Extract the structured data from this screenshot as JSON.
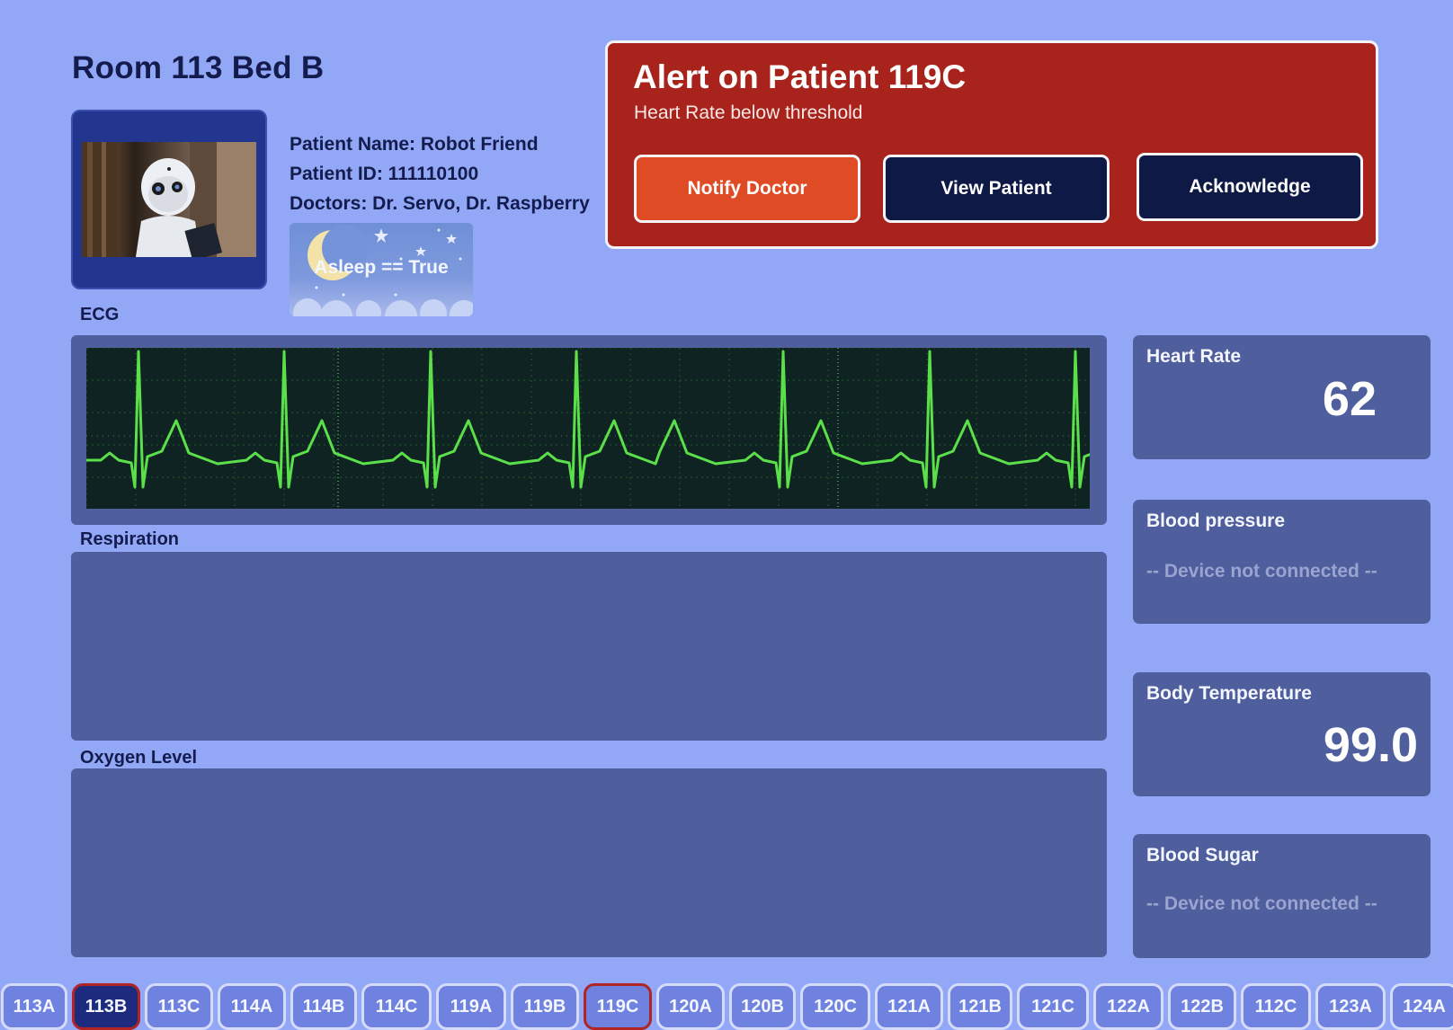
{
  "room": {
    "title": "Room 113 Bed B"
  },
  "patient": {
    "name_line": "Patient Name: Robot Friend",
    "id_line": "Patient ID: 111110100",
    "doctors_line": "Doctors: Dr. Servo, Dr. Raspberry",
    "sleep_status": "Asleep == True"
  },
  "alert": {
    "title": "Alert on Patient 119C",
    "subtitle": "Heart Rate below threshold",
    "notify_label": "Notify Doctor",
    "view_label": "View Patient",
    "ack_label": "Acknowledge",
    "color": "#a8231c"
  },
  "sections": {
    "ecg_label": "ECG",
    "respiration_label": "Respiration",
    "oxygen_label": "Oxygen Level"
  },
  "vitals": {
    "heart_rate": {
      "label": "Heart Rate",
      "value": "62"
    },
    "blood_pressure": {
      "label": "Blood pressure",
      "status": "-- Device not connected --"
    },
    "body_temperature": {
      "label": "Body Temperature",
      "value": "99.0"
    },
    "blood_sugar": {
      "label": "Blood Sugar",
      "status": "-- Device not connected --"
    }
  },
  "bed_tabs": [
    "113A",
    "113B",
    "113C",
    "114A",
    "114B",
    "114C",
    "119A",
    "119B",
    "119C",
    "120A",
    "120B",
    "120C",
    "121A",
    "121B",
    "121C",
    "122A",
    "122B",
    "112C",
    "123A",
    "124A"
  ],
  "active_tab": "113B",
  "alerting_tab": "119C",
  "colors": {
    "background": "#93a7f7",
    "panel": "#4f5e9c",
    "ecg_trace": "#5be04a",
    "ecg_screen": "#0f2422",
    "notify": "#de4b24",
    "dark_button": "#0f1946"
  }
}
